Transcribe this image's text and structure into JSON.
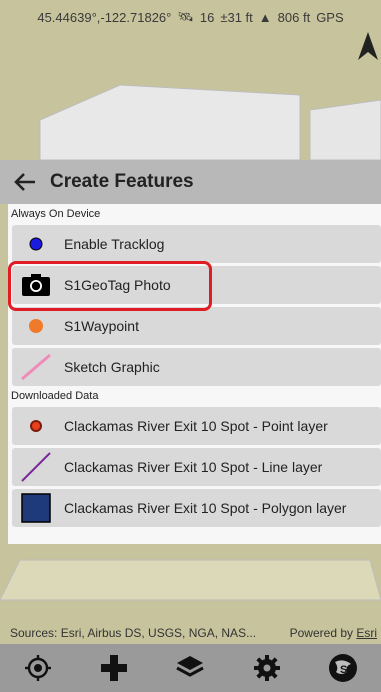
{
  "status": {
    "coords": "45.44639°,-122.71826°",
    "satellites": "16",
    "accuracy": "±31 ft",
    "elevation": "806 ft",
    "source": "GPS"
  },
  "panel": {
    "title": "Create Features"
  },
  "sections": {
    "device": "Always On Device",
    "downloaded": "Downloaded Data"
  },
  "device_items": [
    {
      "label": "Enable Tracklog",
      "icon": "blue-dot-icon"
    },
    {
      "label": "S1GeoTag Photo",
      "icon": "camera-icon"
    },
    {
      "label": "S1Waypoint",
      "icon": "orange-dot-icon"
    },
    {
      "label": "Sketch Graphic",
      "icon": "pink-line-icon"
    }
  ],
  "downloaded_items": [
    {
      "label": "Clackamas River Exit 10 Spot - Point layer",
      "icon": "red-point-icon"
    },
    {
      "label": "Clackamas River Exit 10 Spot - Line layer",
      "icon": "purple-line-icon"
    },
    {
      "label": "Clackamas River Exit 10 Spot - Polygon layer",
      "icon": "polygon-icon"
    }
  ],
  "attribution": {
    "sources": "Sources: Esri, Airbus DS, USGS, NGA, NAS...",
    "powered_prefix": "Powered by ",
    "powered_link": "Esri"
  },
  "toolbar": [
    "locate-icon",
    "add-icon",
    "layers-icon",
    "settings-icon",
    "s1-logo-icon"
  ],
  "colors": {
    "highlight": "#e01c24",
    "tracklog": "#1a1ae0",
    "waypoint": "#f07a2a",
    "sketch": "#f08bb8",
    "point": "#e8401c",
    "line": "#7a2a9a",
    "polygon": "#1e3a7a"
  }
}
